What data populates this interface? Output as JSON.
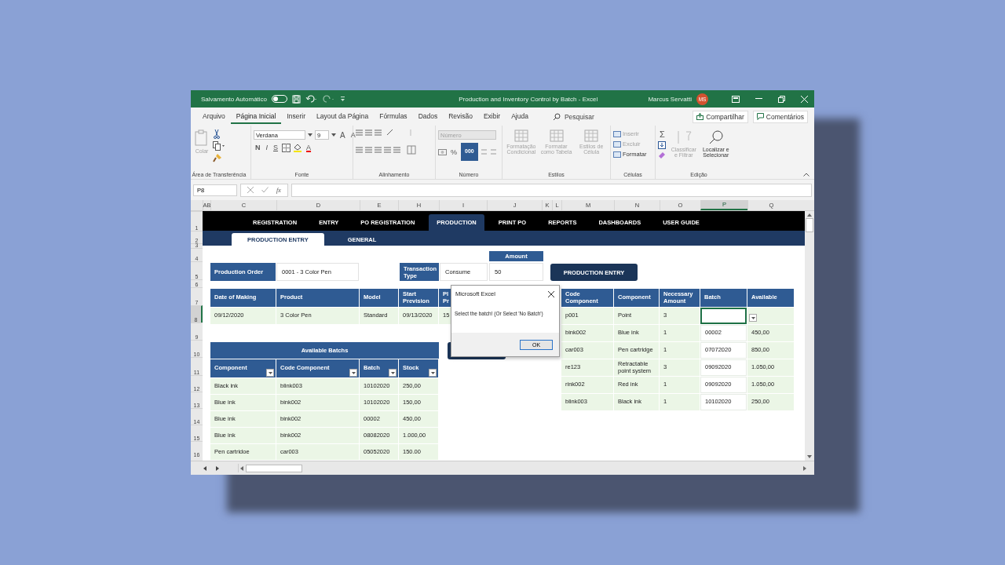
{
  "title_bar": {
    "autosave_label": "Salvamento Automático",
    "autosave_on": false,
    "title": "Production and Inventory Control by Batch - Excel",
    "user": "Marcus Servatti",
    "avatar": "MS"
  },
  "menu_tabs": [
    {
      "label": "Arquivo",
      "selected": false
    },
    {
      "label": "Página Inicial",
      "selected": true
    },
    {
      "label": "Inserir",
      "selected": false
    },
    {
      "label": "Layout da Página",
      "selected": false
    },
    {
      "label": "Fórmulas",
      "selected": false
    },
    {
      "label": "Dados",
      "selected": false
    },
    {
      "label": "Revisão",
      "selected": false
    },
    {
      "label": "Exibir",
      "selected": false
    },
    {
      "label": "Ajuda",
      "selected": false
    }
  ],
  "search": {
    "placeholder": "Pesquisar"
  },
  "share_button": "Compartilhar",
  "comments_button": "Comentários",
  "ribbon": {
    "clipboard": {
      "label": "Área de Transferência",
      "paste": "Colar",
      "paste_disabled": true
    },
    "font": {
      "label": "Fonte",
      "family": "Verdana",
      "size": "9",
      "grow": "A",
      "shrink": "A",
      "bold": "N",
      "italic": "I",
      "underline": "S",
      "font_color": "A"
    },
    "alignment": {
      "label": "Alinhamento"
    },
    "number": {
      "label": "Número",
      "format": "Número",
      "format_disabled": true,
      "percent": "%",
      "thousands": "000"
    },
    "styles": {
      "label": "Estilos",
      "items": [
        {
          "label": "Formatação Condicional",
          "disabled": true
        },
        {
          "label": "Formatar como Tabela",
          "disabled": true
        },
        {
          "label": "Estilos de Célula",
          "disabled": true
        }
      ]
    },
    "cells": {
      "label": "Células",
      "items": [
        {
          "label": "Inserir",
          "disabled": true
        },
        {
          "label": "Excluir",
          "disabled": true
        },
        {
          "label": "Formatar",
          "disabled": false
        }
      ]
    },
    "editing": {
      "label": "Edição",
      "sum": "Σ",
      "items": [
        {
          "label": "Classificar e Filtrar",
          "disabled": true
        },
        {
          "label": "Localizar e Selecionar",
          "disabled": false
        }
      ]
    }
  },
  "formula_bar": {
    "name_box": "P8",
    "fx": "fx"
  },
  "columns": [
    {
      "label": "AB",
      "selected": false
    },
    {
      "label": "C",
      "selected": false
    },
    {
      "label": "D",
      "selected": false
    },
    {
      "label": "E",
      "selected": false
    },
    {
      "label": "H",
      "selected": false
    },
    {
      "label": "I",
      "selected": false
    },
    {
      "label": "J",
      "selected": false
    },
    {
      "label": "K",
      "selected": false
    },
    {
      "label": "L",
      "selected": false
    },
    {
      "label": "M",
      "selected": false
    },
    {
      "label": "N",
      "selected": false
    },
    {
      "label": "O",
      "selected": false
    },
    {
      "label": "P",
      "selected": true
    },
    {
      "label": "Q",
      "selected": false
    }
  ],
  "rows": [
    {
      "label": "1",
      "selected": false
    },
    {
      "label": "2",
      "selected": false
    },
    {
      "label": "3",
      "selected": false
    },
    {
      "label": "4",
      "selected": false
    },
    {
      "label": "5",
      "selected": false
    },
    {
      "label": "6",
      "selected": false
    },
    {
      "label": "7",
      "selected": false
    },
    {
      "label": "8",
      "selected": true
    },
    {
      "label": "9",
      "selected": false
    },
    {
      "label": "10",
      "selected": false
    },
    {
      "label": "11",
      "selected": false
    },
    {
      "label": "12",
      "selected": false
    },
    {
      "label": "13",
      "selected": false
    },
    {
      "label": "14",
      "selected": false
    },
    {
      "label": "15",
      "selected": false
    },
    {
      "label": "16",
      "selected": false
    }
  ],
  "nav_tabs": [
    {
      "label": "REGISTRATION",
      "selected": false
    },
    {
      "label": "ENTRY",
      "selected": false
    },
    {
      "label": "PO REGISTRATION",
      "selected": false
    },
    {
      "label": "PRODUCTION",
      "selected": true
    },
    {
      "label": "PRINT PO",
      "selected": false
    },
    {
      "label": "REPORTS",
      "selected": false
    },
    {
      "label": "DASHBOARDS",
      "selected": false
    },
    {
      "label": "USER GUIDE",
      "selected": false
    }
  ],
  "sub_tabs": [
    {
      "label": "PRODUCTION ENTRY",
      "selected": true
    },
    {
      "label": "GENERAL",
      "selected": false
    }
  ],
  "form": {
    "production_order_label": "Production Order",
    "production_order": "0001 - 3 Color Pen",
    "transaction_type_label": "Transaction Type",
    "transaction_type": "Consume",
    "amount_label": "Amount",
    "amount": "50",
    "entry_button": "PRODUCTION ENTRY"
  },
  "order_table": {
    "columns": [
      "Date of Making",
      "Product",
      "Model",
      "Start Prevision",
      "Pl Pr"
    ],
    "rows": [
      [
        "09/12/2020",
        "3 Color Pen",
        "Standard",
        "09/13/2020",
        "15"
      ]
    ]
  },
  "batches_table": {
    "title": "Available Batchs",
    "columns": [
      "Component",
      "Code Component",
      "Batch",
      "Stock"
    ],
    "rows": [
      [
        "Black ink",
        "blink003",
        "10102020",
        "250,00"
      ],
      [
        "Blue ink",
        "bink002",
        "10102020",
        "150,00"
      ],
      [
        "Blue ink",
        "bink002",
        "00002",
        "450,00"
      ],
      [
        "Blue ink",
        "bink002",
        "08082020",
        "1.000,00"
      ],
      [
        "Pen cartridoe",
        "car003",
        "05052020",
        "150.00"
      ]
    ]
  },
  "components_table": {
    "columns": [
      "Code Component",
      "Component",
      "Necessary Amount",
      "Batch",
      "Available"
    ],
    "rows": [
      {
        "code": "p001",
        "component": "Point",
        "necessary": "3",
        "batch_selected": true
      },
      {
        "code": "bink002",
        "component": "Blue ink",
        "necessary": "1",
        "batch": "00002",
        "available": "450,00",
        "batch_selected": false
      },
      {
        "code": "car003",
        "component": "Pen cartridge",
        "necessary": "1",
        "batch": "07072020",
        "available": "850,00",
        "batch_selected": false
      },
      {
        "code": "re123",
        "component": "Retractable point system",
        "necessary": "3",
        "batch": "09092020",
        "available": "1.050,00",
        "batch_selected": false
      },
      {
        "code": "rink002",
        "component": "Red ink",
        "necessary": "1",
        "batch": "09092020",
        "available": "1.050,00",
        "batch_selected": false
      },
      {
        "code": "blink003",
        "component": "Black ink",
        "necessary": "1",
        "batch": "10102020",
        "available": "250,00",
        "batch_selected": false
      }
    ]
  },
  "dialog": {
    "title": "Microsoft Excel",
    "message": "Select the batch! (Or Select 'No Batch')",
    "ok_button": "OK"
  }
}
